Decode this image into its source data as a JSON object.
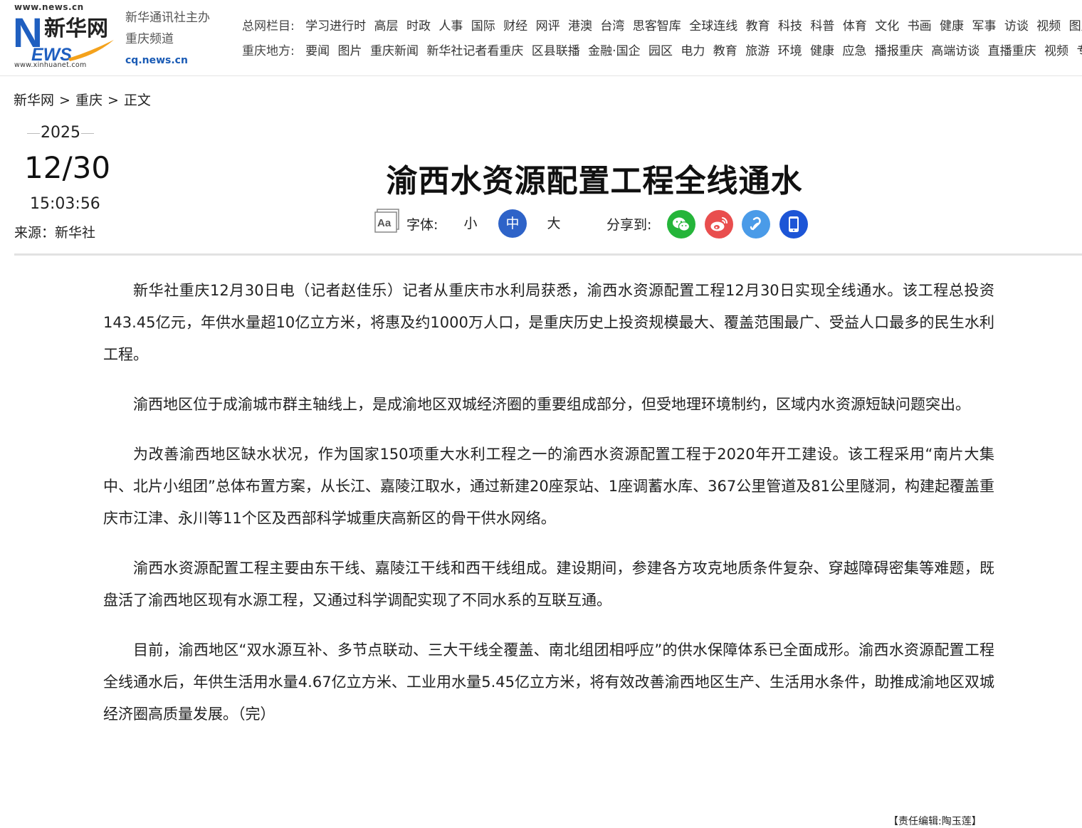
{
  "logo": {
    "url_top": "www.news.cn",
    "url_bottom": "www.xinhuanet.com",
    "brand": "新华网",
    "letters_n": "N",
    "letters_ews": "EWS",
    "colors": {
      "blue": "#1f5fc0",
      "orange": "#f4a21c",
      "ink": "#222222"
    }
  },
  "sponsor": {
    "line1": "新华通讯社主办",
    "line2": "重庆频道",
    "site": "cq.news.cn"
  },
  "nav": {
    "main_label": "总网栏目:",
    "main_items": [
      "学习进行时",
      "高层",
      "时政",
      "人事",
      "国际",
      "财经",
      "网评",
      "港澳",
      "台湾",
      "思客智库",
      "全球连线",
      "教育",
      "科技",
      "科普",
      "体育",
      "文化",
      "书画",
      "健康",
      "军事",
      "访谈",
      "视频",
      "图片"
    ],
    "local_label": "重庆地方:",
    "local_items": [
      "要闻",
      "图片",
      "重庆新闻",
      "新华社记者看重庆",
      "区县联播",
      "金融·国企",
      "园区",
      "电力",
      "教育",
      "旅游",
      "环境",
      "健康",
      "应急",
      "播报重庆",
      "高端访谈",
      "直播重庆",
      "视频",
      "专题"
    ]
  },
  "breadcrumb": {
    "home": "新华网",
    "section": "重庆",
    "current": "正文",
    "separator": ">"
  },
  "date": {
    "year": "2025",
    "day": "12/30",
    "time": "15:03:56"
  },
  "source": "来源：新华社",
  "article_title": "渝西水资源配置工程全线通水",
  "tools": {
    "aa_icon": "font-size-icon",
    "font_label": "字体:",
    "sizes": {
      "small": "小",
      "medium": "中",
      "large": "大"
    },
    "share_label": "分享到:",
    "share_icons": [
      "wechat-icon",
      "weibo-icon",
      "link-icon",
      "mobile-icon"
    ],
    "accent": "#2e63c8"
  },
  "article": {
    "paragraphs": [
      "新华社重庆12月30日电（记者赵佳乐）记者从重庆市水利局获悉，渝西水资源配置工程12月30日实现全线通水。该工程总投资143.45亿元，年供水量超10亿立方米，将惠及约1000万人口，是重庆历史上投资规模最大、覆盖范围最广、受益人口最多的民生水利工程。",
      "渝西地区位于成渝城市群主轴线上，是成渝地区双城经济圈的重要组成部分，但受地理环境制约，区域内水资源短缺问题突出。",
      "为改善渝西地区缺水状况，作为国家150项重大水利工程之一的渝西水资源配置工程于2020年开工建设。该工程采用“南片大集中、北片小组团”总体布置方案，从长江、嘉陵江取水，通过新建20座泵站、1座调蓄水库、367公里管道及81公里隧洞，构建起覆盖重庆市江津、永川等11个区及西部科学城重庆高新区的骨干供水网络。",
      "渝西水资源配置工程主要由东干线、嘉陵江干线和西干线组成。建设期间，参建各方攻克地质条件复杂、穿越障碍密集等难题，既盘活了渝西地区现有水源工程，又通过科学调配实现了不同水系的互联互通。",
      "目前，渝西地区“双水源互补、多节点联动、三大干线全覆盖、南北组团相呼应”的供水保障体系已全面成形。渝西水资源配置工程全线通水后，年供生活用水量4.67亿立方米、工业用水量5.45亿立方米，将有效改善渝西地区生产、生活用水条件，助推成渝地区双城经济圈高质量发展。（完）"
    ]
  },
  "editor": "【责任编辑:陶玉莲】"
}
